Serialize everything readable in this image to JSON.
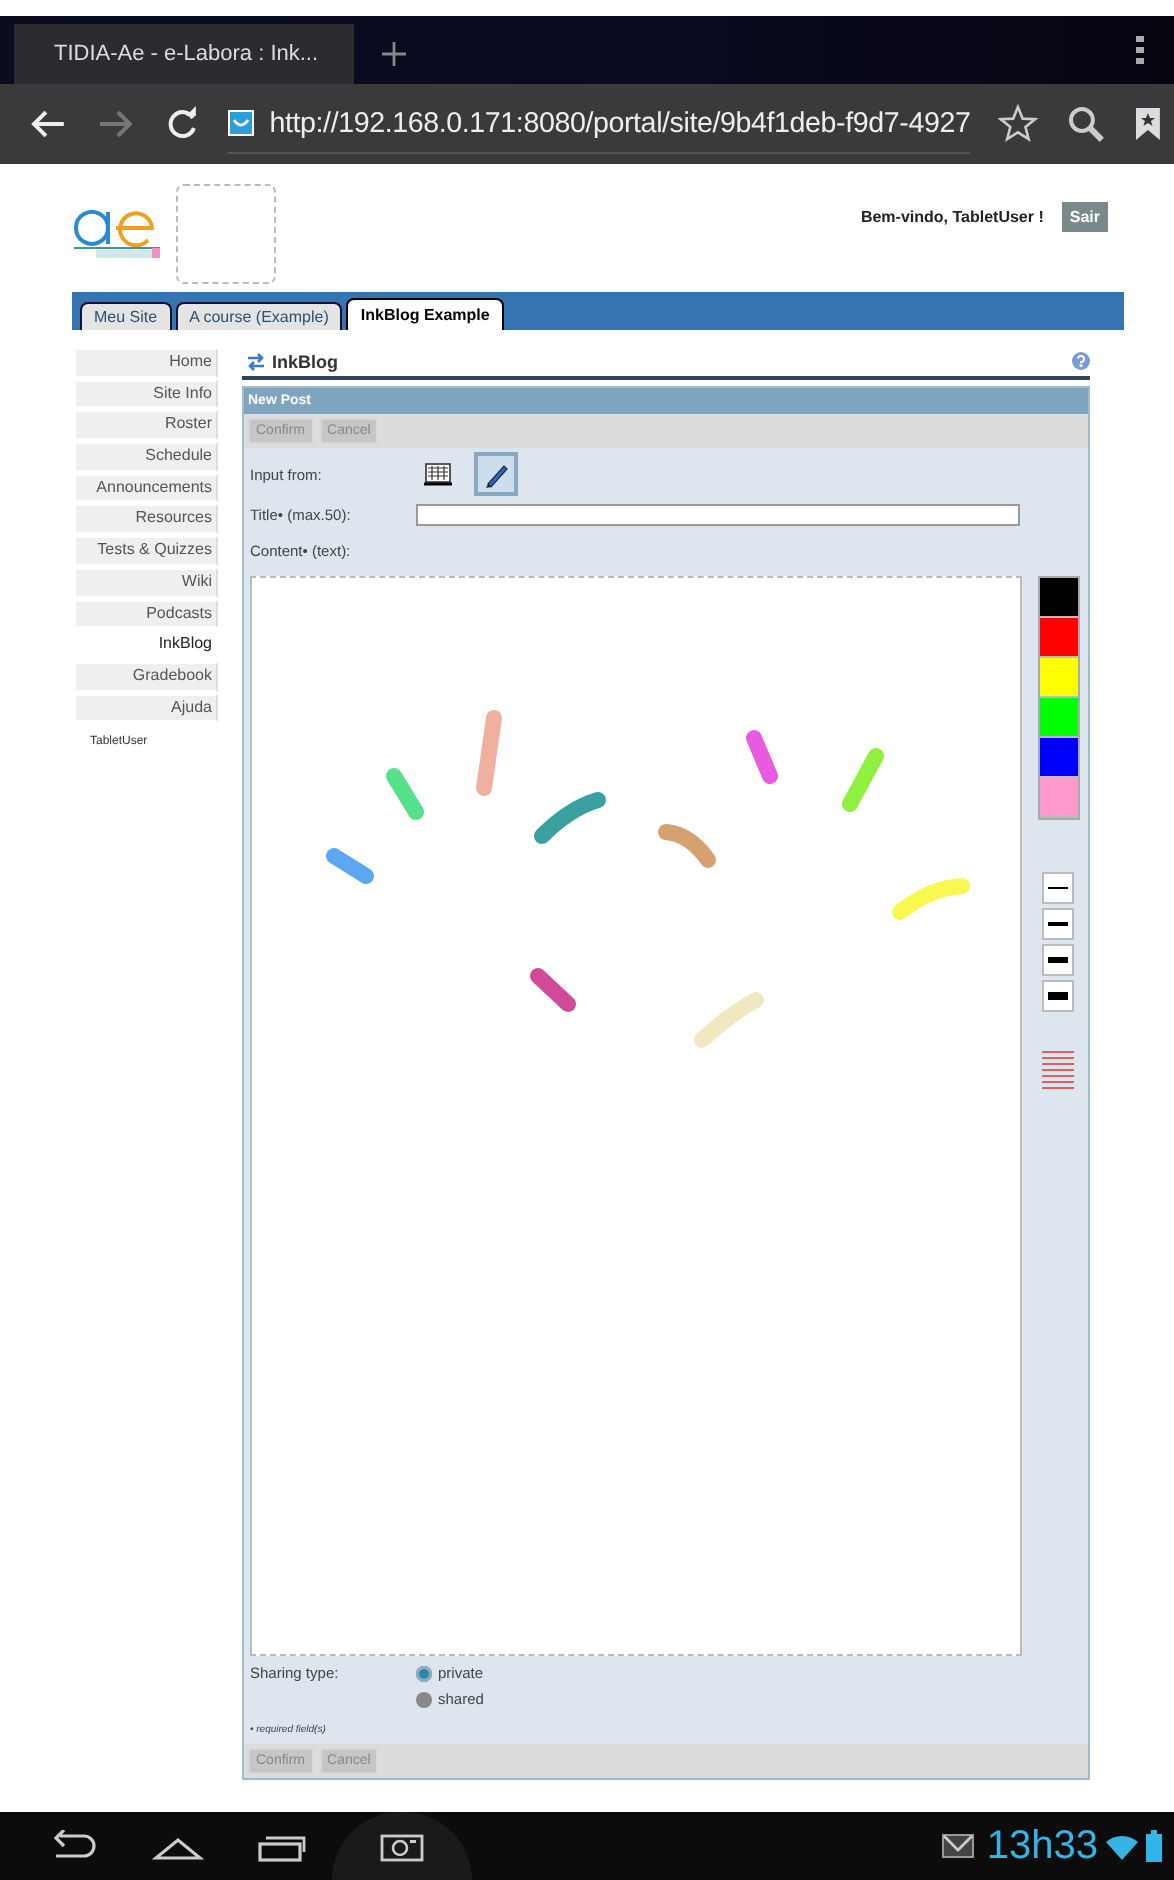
{
  "browser": {
    "tab_title": "TIDIA-Ae - e-Labora : Ink...",
    "url": "http://192.168.0.171:8080/portal/site/9b4f1deb-f9d7-4927"
  },
  "header": {
    "welcome": "Bem-vindo, TabletUser !",
    "logout": "Sair"
  },
  "site_tabs": [
    {
      "label": "Meu Site",
      "selected": false
    },
    {
      "label": "A course (Example)",
      "selected": false
    },
    {
      "label": "InkBlog Example",
      "selected": true
    }
  ],
  "sidebar": {
    "items": [
      {
        "label": "Home",
        "selected": false
      },
      {
        "label": "Site Info",
        "selected": false
      },
      {
        "label": "Roster",
        "selected": false
      },
      {
        "label": "Schedule",
        "selected": false
      },
      {
        "label": "Announcements",
        "selected": false
      },
      {
        "label": "Resources",
        "selected": false
      },
      {
        "label": "Tests & Quizzes",
        "selected": false
      },
      {
        "label": "Wiki",
        "selected": false
      },
      {
        "label": "Podcasts",
        "selected": false
      },
      {
        "label": "InkBlog",
        "selected": true
      },
      {
        "label": "Gradebook",
        "selected": false
      },
      {
        "label": "Ajuda",
        "selected": false
      }
    ],
    "user": "TabletUser"
  },
  "tool": {
    "title": "InkBlog",
    "panel_title": "New Post",
    "top_buttons": [
      "Confirm",
      "Cancel"
    ],
    "input_from": {
      "label": "Input from:",
      "modes": [
        {
          "kind": "keyboard",
          "selected": false
        },
        {
          "kind": "pen",
          "selected": true
        }
      ]
    },
    "title_field": {
      "label": "Title• (max.50):"
    },
    "content_label": "Content• (text):",
    "palette": [
      {
        "color": "#000000"
      },
      {
        "color": "#ff0000"
      },
      {
        "color": "#ffff00"
      },
      {
        "color": "#00ff00"
      },
      {
        "color": "#0000ff"
      },
      {
        "color": "#ff99cc"
      }
    ],
    "sharing": {
      "label": "Sharing type:",
      "options": [
        {
          "label": "private",
          "selected": true
        },
        {
          "label": "shared",
          "selected": false
        }
      ]
    },
    "required_note": "• required field(s)",
    "bottom_buttons": [
      "Confirm",
      "Cancel"
    ]
  },
  "system_bar": {
    "time": "13h33"
  }
}
